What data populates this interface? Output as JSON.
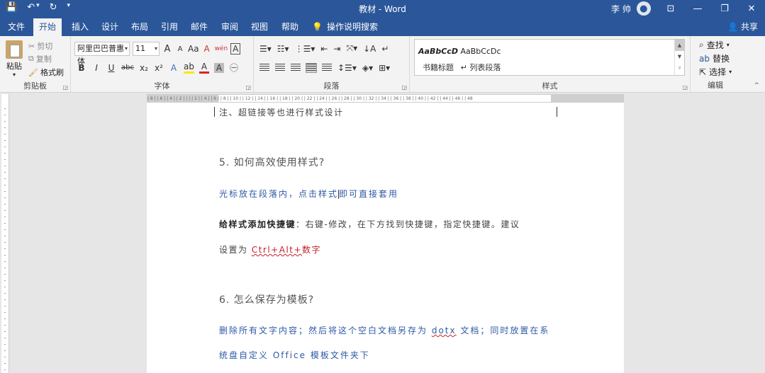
{
  "titlebar": {
    "title": "教材 - Word",
    "user_name": "李 帅",
    "qat": {
      "save": "💾",
      "undo": "↶",
      "undo_dd": "▾",
      "redo": "↻",
      "customize": "▾"
    },
    "controls": {
      "ribbon_display": "⊡",
      "minimize": "—",
      "restore": "❐",
      "close": "✕"
    }
  },
  "tabs": [
    "文件",
    "开始",
    "插入",
    "设计",
    "布局",
    "引用",
    "邮件",
    "审阅",
    "视图",
    "帮助"
  ],
  "active_tab": "开始",
  "tell_me": "操作说明搜索",
  "share": "共享",
  "clipboard": {
    "paste": "粘贴",
    "cut": "剪切",
    "copy": "复制",
    "format_painter": "格式刷",
    "group_label": "剪贴板"
  },
  "font": {
    "font_name": "阿里巴巴普惠体",
    "font_size": "11",
    "grow": "A",
    "shrink": "A",
    "change_case": "Aa",
    "clear_format": "A",
    "phonetic": "wén",
    "border_char": "A",
    "bold": "B",
    "italic": "I",
    "underline": "U",
    "strike": "abc",
    "subscript": "x₂",
    "superscript": "x²",
    "text_effect": "A",
    "highlight": "ab",
    "font_color": "A",
    "char_shading": "A",
    "enclose": "㊀",
    "group_label": "字体"
  },
  "paragraph": {
    "group_label": "段落"
  },
  "styles": {
    "items": [
      {
        "sample": "AaBbCcD",
        "name": "书籍标题"
      },
      {
        "sample": "AaBbCcDc",
        "name": "↵ 列表段落"
      }
    ],
    "group_label": "样式"
  },
  "editing": {
    "find": "查找",
    "replace": "替换",
    "select": "选择",
    "group_label": "编辑"
  },
  "ruler": {
    "ticks": "| 8 | | 6 | | 4 | | 2 | | | | 2 | | 4 | | 6 | | 8 | | 10 | | 12 | | 14 | | 16 | | 18 | | 20 | | 22 | | 24 | | 26 | | 28 | | 30 | | 32 | | 34 | | 36 | | 38 | | 40 | | 42 | | 44 | | 46 | | 48"
  },
  "document": {
    "line_top": "注、超链接等也进行样式设计",
    "h5": "5. 如何高效使用样式?",
    "blue1_a": "光标放在段落内，点击样式",
    "blue1_b": "即可直接套用",
    "bold_lead": "给样式添加快捷键",
    "body1": "：右键-修改，在下方找到快捷键，指定快捷键。建议",
    "body2_lead": "设置为 ",
    "shortcut": "Ctrl+Alt+",
    "shortcut_tail": "数字",
    "h6": "6. 怎么保存为模板?",
    "blue2_a": "删除所有文字内容；然后将这个空白文档另存为 ",
    "blue2_dotx": "dotx",
    "blue2_b": " 文档；同时放置在系",
    "blue3": "统盘自定义 Office 模板文件夹下"
  },
  "colors": {
    "accent": "#2b579a",
    "link_blue": "#2e5aa6",
    "red": "#c7202a"
  }
}
